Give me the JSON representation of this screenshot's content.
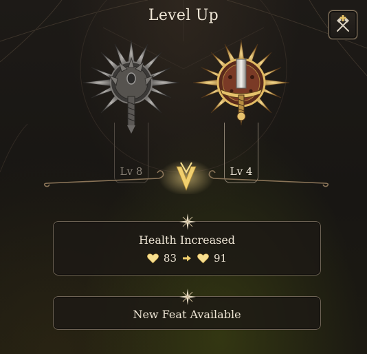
{
  "header": {
    "title": "Level Up"
  },
  "classes": [
    {
      "level_label": "Lv 8",
      "icon": "mace-emblem-icon",
      "state": "inactive"
    },
    {
      "level_label": "Lv 4",
      "icon": "sword-emblem-icon",
      "state": "selected"
    }
  ],
  "toolbar": {
    "icon": "respec-tools-icon"
  },
  "panels": {
    "health": {
      "title": "Health Increased",
      "from": "83",
      "to": "91",
      "icon": "heart-icon"
    },
    "feat": {
      "title": "New Feat Available"
    }
  },
  "colors": {
    "gold": "#e8c469",
    "silver": "#9a9896",
    "panel_border": "#6f6456",
    "text": "#eee5d5"
  }
}
